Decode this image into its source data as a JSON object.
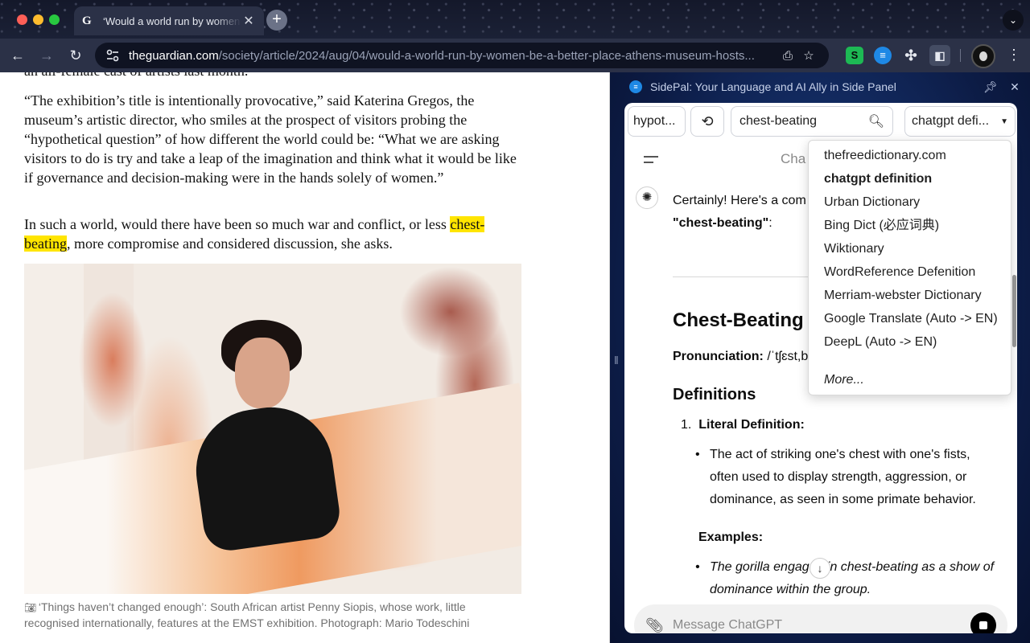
{
  "browser": {
    "tab_title": "‘Would a world run by women be a better place’",
    "tab_favicon": "G",
    "url_domain": "theguardian.com",
    "url_path": "/society/article/2024/aug/04/would-a-world-run-by-women-be-a-better-place-athens-museum-hosts..."
  },
  "article": {
    "cut_line": "an all-female cast of artists last month.",
    "para1": "“The exhibition’s title is intentionally provocative,” said Katerina Gregos, the museum’s artistic director, who smiles at the prospect of visitors probing the “hypothetical question” of how different the world could be: “What we are asking visitors to do is try and take a leap of the imagination and think what it would be like if governance and decision-making were in the hands solely of women.”",
    "para2_before": "In such a world, would there have been so much war and conflict, or less ",
    "para2_highlight": "chest-beating",
    "para2_after": ", more compromise and considered discussion, she asks.",
    "caption": "‘Things haven’t changed enough’: South African artist Penny Siopis, whose work, little recognised internationally, features at the EMST exhibition. Photograph: Mario Todeschini"
  },
  "sidepanel": {
    "header_title": "SidePal: Your Language and AI Ally in Side Panel",
    "history_word": "hypot...",
    "search_query": "chest-beating",
    "source_selected": "chatgpt defi...",
    "dropdown_options": [
      "thefreedictionary.com",
      "chatgpt definition",
      "Urban Dictionary",
      "Bing Dict (必应词典)",
      "Wiktionary",
      "WordReference Defenition",
      "Merriam-webster Dictionary",
      "Google Translate (Auto -> EN)",
      "DeepL (Auto -> EN)"
    ],
    "dropdown_more": "More..."
  },
  "chat": {
    "title": "Cha",
    "intro_text": "Certainly! Here's a com",
    "intro_bold": "\"chest-beating\"",
    "intro_colon": ":",
    "heading": "Chest-Beating",
    "pronunciation_label": "Pronunciation:",
    "pronunciation_value": " /ˈtʃɛst,b",
    "definitions_heading": "Definitions",
    "item1_number": "1.",
    "item1_label": "Literal Definition:",
    "item1_bullet": "The act of striking one's chest with one's fists, often used to display strength, aggression, or dominance, as seen in some primate behavior.",
    "examples_label": "Examples:",
    "example1": "The gorilla engaged in chest-beating as a show of dominance within the group.",
    "composer_placeholder": "Message ChatGPT"
  },
  "colors": {
    "highlight": "#ffe500",
    "chrome_bg": "#2b3147",
    "panel_bg": "#0c1b44"
  }
}
